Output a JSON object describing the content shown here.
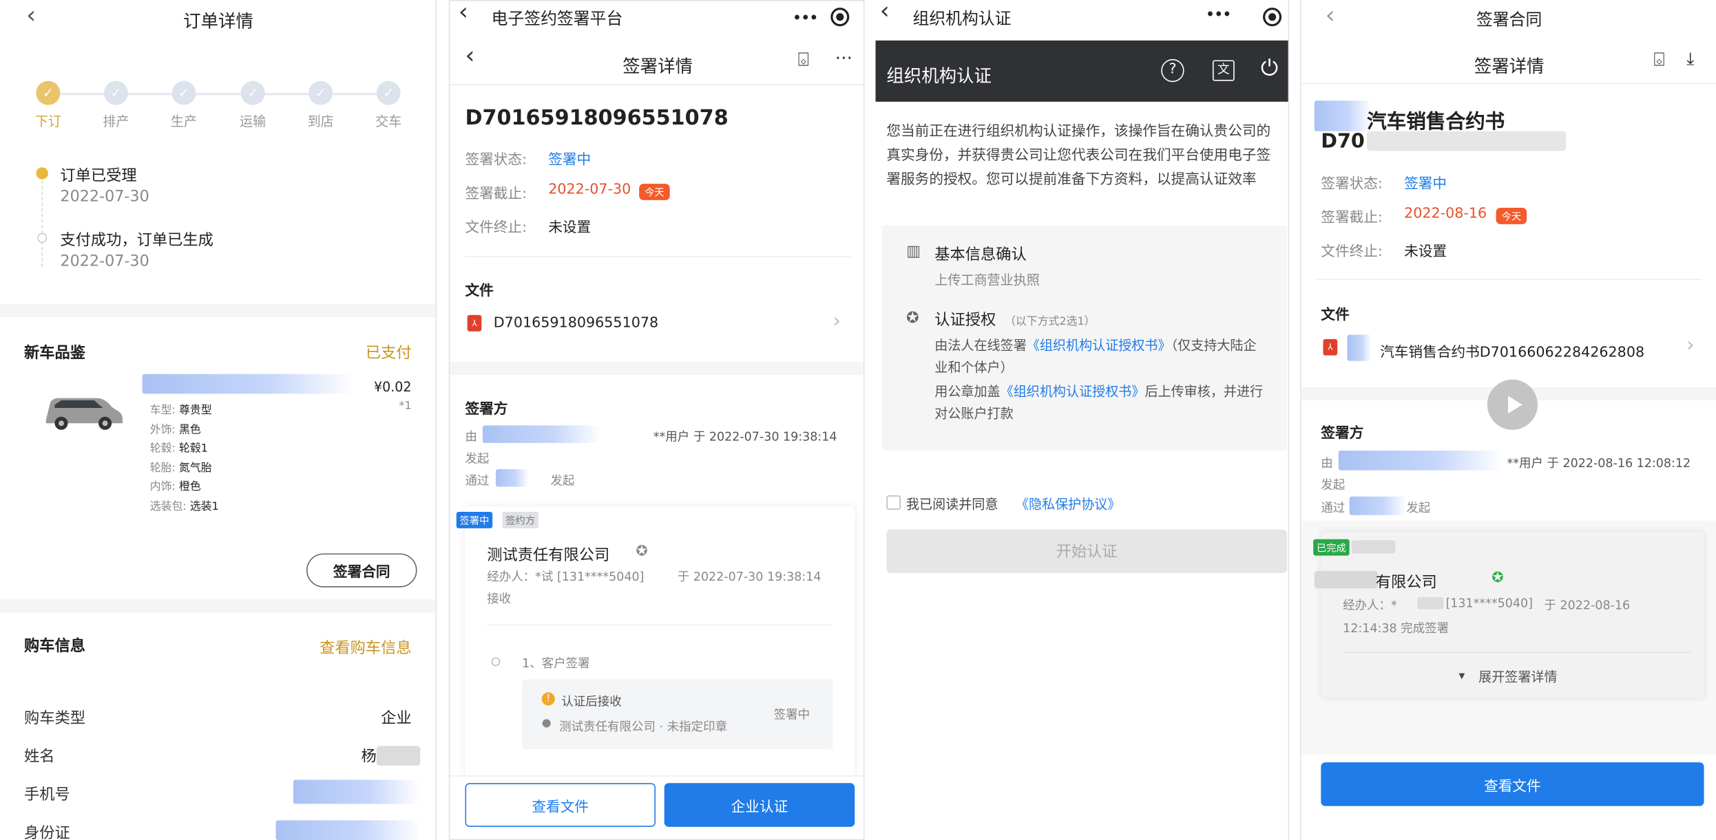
{
  "p1": {
    "title": "订单详情",
    "steps": [
      "下订",
      "排产",
      "生产",
      "运输",
      "到店",
      "交车"
    ],
    "timeline": [
      {
        "text": "订单已受理",
        "date": "2022-07-30"
      },
      {
        "text": "支付成功，订单已生成",
        "date": "2022-07-30"
      }
    ],
    "card_title": "新车品鉴",
    "card_status": "已支付",
    "price": "¥0.02",
    "qty": "*1",
    "specs": [
      {
        "k": "车型:",
        "v": "尊贵型"
      },
      {
        "k": "外饰:",
        "v": "黑色"
      },
      {
        "k": "轮毂:",
        "v": "轮毂1"
      },
      {
        "k": "轮胎:",
        "v": "氮气胎"
      },
      {
        "k": "内饰:",
        "v": "橙色"
      },
      {
        "k": "选装包:",
        "v": "选装1"
      }
    ],
    "sign_btn": "签署合同",
    "buy_title": "购车信息",
    "buy_link": "查看购车信息",
    "rows": [
      {
        "k": "购车类型",
        "v": "企业"
      },
      {
        "k": "姓名",
        "v": "杨"
      },
      {
        "k": "手机号",
        "v": ""
      },
      {
        "k": "身份证",
        "v": ""
      }
    ]
  },
  "p2": {
    "app_title": "电子签约签署平台",
    "page_title": "签署详情",
    "doc_no": "D70165918096551078",
    "status_label": "签署状态:",
    "status_value": "签署中",
    "deadline_label": "签署截止:",
    "deadline_value": "2022-07-30",
    "today": "今天",
    "end_label": "文件终止:",
    "end_value": "未设置",
    "file_section": "文件",
    "file_name": "D70165918096551078",
    "party_section": "签署方",
    "by_prefix": "由",
    "by_suffix": "**用户 于 2022-07-30 19:38:14",
    "initiated": "发起",
    "via_prefix": "通过",
    "via_suffix": "发起",
    "tag_signing": "签署中",
    "tag_party": "签约方",
    "company": "测试责任有限公司",
    "agent": "经办人：*试 [131****5040]",
    "agent_time": "于 2022-07-30 19:38:14",
    "accept": "接收",
    "step_title": "1、客户签署",
    "notice": "认证后接收",
    "seal": "测试责任有限公司 · 未指定印章",
    "step_status": "签署中",
    "btn_view": "查看文件",
    "btn_auth": "企业认证"
  },
  "p3": {
    "app_title": "组织机构认证",
    "bar_title": "组织机构认证",
    "intro": "您当前正在进行组织机构认证操作，该操作旨在确认贵公司的真实身份，并获得贵公司让您代表公司在我们平台使用电子签署服务的授权。您可以提前准备下方资料，以提高认证效率",
    "sec1_title": "基本信息确认",
    "sec1_sub": "上传工商营业执照",
    "sec2_title": "认证授权",
    "sec2_note": "（以下方式2选1）",
    "opt1_a": "由法人在线签署",
    "opt1_link": "《组织机构认证授权书》",
    "opt1_b": "（仅支持大陆企业和个体户）",
    "opt2_a": "用公章加盖",
    "opt2_link": "《组织机构认证授权书》",
    "opt2_b": "后上传审核，并进行对公账户打款",
    "agree_text": "我已阅读并同意",
    "agree_link": "《隐私保护协议》",
    "start_btn": "开始认证"
  },
  "p4": {
    "app_title": "签署合同",
    "page_title": "签署详情",
    "doc_title": "汽车销售合约书",
    "doc_no": "D701",
    "status_label": "签署状态:",
    "status_value": "签署中",
    "deadline_label": "签署截止:",
    "deadline_value": "2022-08-16",
    "today": "今天",
    "end_label": "文件终止:",
    "end_value": "未设置",
    "file_section": "文件",
    "file_name": "汽车销售合约书D70166062284262808",
    "party_section": "签署方",
    "by_prefix": "由",
    "by_suffix": "**用户 于 2022-08-16 12:08:12",
    "initiated": "发起",
    "via_prefix": "通过",
    "via_suffix": "发起",
    "tag_done": "已完成",
    "company": "有限公司",
    "agent": "经办人：*",
    "agent_phone": "[131****5040]",
    "agent_time": "于 2022-08-16",
    "agent_time2": "12:14:38 完成签署",
    "expand": "展开签署详情",
    "btn_view": "查看文件"
  }
}
